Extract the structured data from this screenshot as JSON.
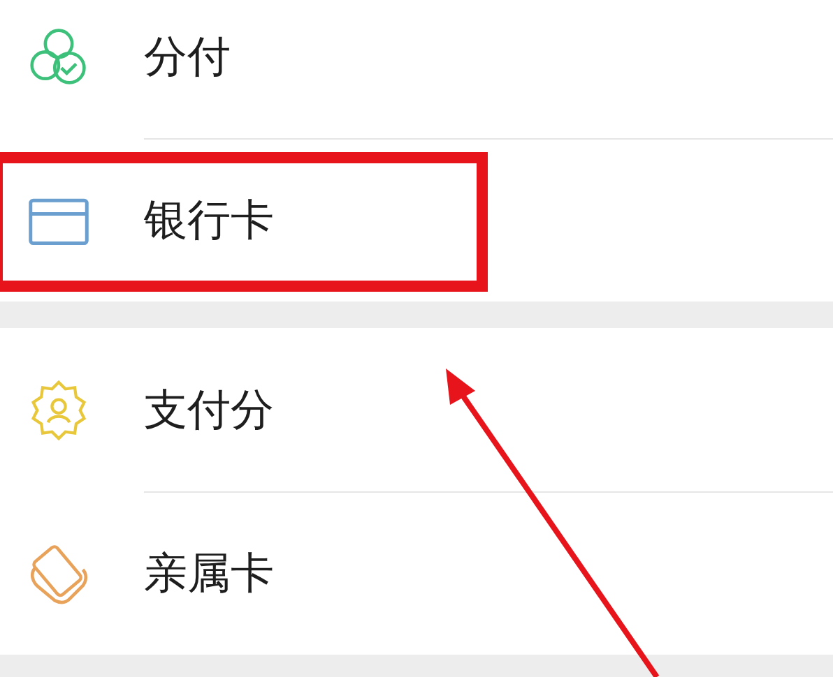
{
  "groups": [
    {
      "items": [
        {
          "kind": "installment",
          "label": "分付",
          "highlighted": false
        },
        {
          "kind": "bank-card",
          "label": "银行卡",
          "highlighted": true
        }
      ]
    },
    {
      "items": [
        {
          "kind": "pay-score",
          "label": "支付分",
          "highlighted": false
        },
        {
          "kind": "family-card",
          "label": "亲属卡",
          "highlighted": false
        }
      ]
    }
  ]
}
